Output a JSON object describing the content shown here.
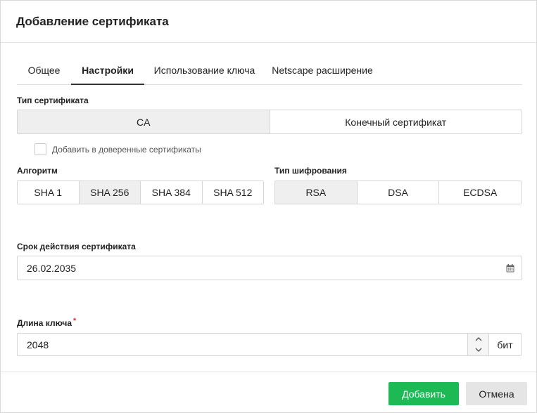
{
  "dialog": {
    "title": "Добавление сертификата"
  },
  "tabs": [
    {
      "label": "Общее",
      "active": false
    },
    {
      "label": "Настройки",
      "active": true
    },
    {
      "label": "Использование ключа",
      "active": false
    },
    {
      "label": "Netscape расширение",
      "active": false
    }
  ],
  "cert_type": {
    "label": "Тип сертификата",
    "options": [
      "CA",
      "Конечный сертификат"
    ],
    "selected": "CA"
  },
  "trusted": {
    "label": "Добавить в доверенные сертификаты",
    "checked": false
  },
  "algorithm": {
    "label": "Алгоритм",
    "options": [
      "SHA 1",
      "SHA 256",
      "SHA 384",
      "SHA 512"
    ],
    "selected": "SHA 256"
  },
  "encryption": {
    "label": "Тип шифрования",
    "options": [
      "RSA",
      "DSA",
      "ECDSA"
    ],
    "selected": "RSA"
  },
  "validity": {
    "label": "Срок действия сертификата",
    "value": "26.02.2035",
    "icon": "calendar-icon"
  },
  "key_length": {
    "label": "Длина ключа",
    "required_mark": "*",
    "value": "2048",
    "unit": "бит"
  },
  "footer": {
    "add_label": "Добавить",
    "cancel_label": "Отмена"
  },
  "colors": {
    "primary": "#1db954",
    "selected_segment": "#efefef",
    "required": "#e03030"
  }
}
